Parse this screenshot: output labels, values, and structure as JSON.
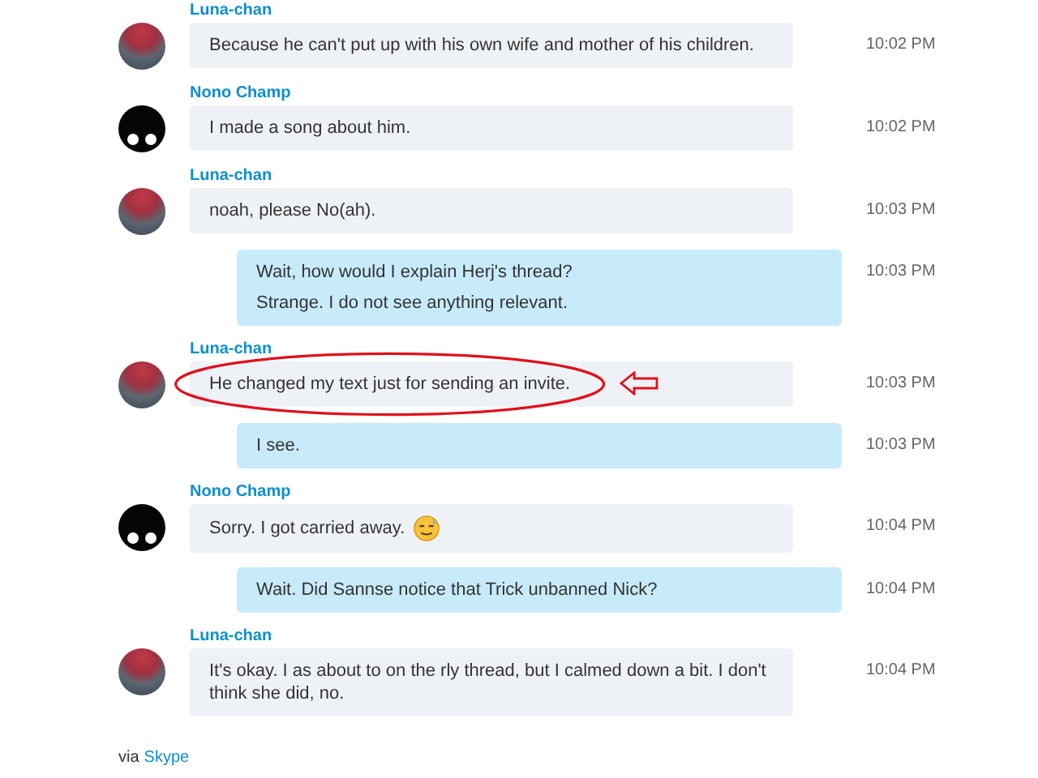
{
  "messages": [
    {
      "kind": "incoming",
      "sender": "Luna-chan",
      "avatar": {
        "kind": "photo"
      },
      "lines": [
        "Because he can't put up with his own wife and mother of his children."
      ],
      "time": "10:02 PM"
    },
    {
      "kind": "incoming",
      "sender": "Nono Champ",
      "avatar": {
        "kind": "eyes"
      },
      "lines": [
        "I made a song about him."
      ],
      "time": "10:02 PM"
    },
    {
      "kind": "incoming",
      "sender": "Luna-chan",
      "avatar": {
        "kind": "photo"
      },
      "lines": [
        "noah, please No(ah)."
      ],
      "time": "10:03 PM"
    },
    {
      "kind": "outgoing",
      "lines": [
        "Wait, how would I explain Herj's thread?",
        "Strange. I do not see anything relevant."
      ],
      "time": "10:03 PM"
    },
    {
      "kind": "incoming",
      "sender": "Luna-chan",
      "avatar": {
        "kind": "photo"
      },
      "lines": [
        "He changed my text just for sending an invite."
      ],
      "time": "10:03 PM",
      "highlighted": true
    },
    {
      "kind": "outgoing",
      "lines": [
        "I see."
      ],
      "time": "10:03 PM"
    },
    {
      "kind": "incoming",
      "sender": "Nono Champ",
      "avatar": {
        "kind": "eyes"
      },
      "lines": [
        "Sorry. I got carried away."
      ],
      "time": "10:04 PM",
      "emoticon": true
    },
    {
      "kind": "outgoing",
      "lines": [
        "Wait. Did Sannse notice that Trick unbanned Nick?"
      ],
      "time": "10:04 PM"
    },
    {
      "kind": "incoming",
      "sender": "Luna-chan",
      "avatar": {
        "kind": "photo"
      },
      "lines": [
        "It's okay. I as about to on the rly thread, but I calmed down a bit. I don't think she did, no."
      ],
      "time": "10:04 PM"
    }
  ],
  "footer": {
    "prefix": "via",
    "link": "Skype"
  }
}
